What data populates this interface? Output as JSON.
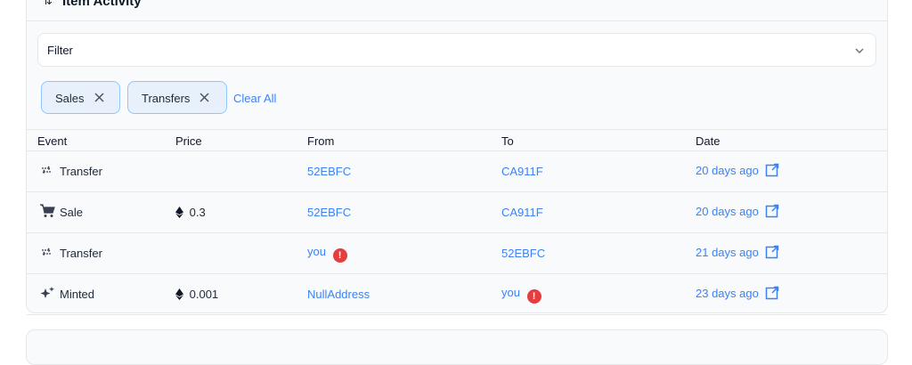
{
  "panel": {
    "title": "Item Activity",
    "title_icon": "swap-vertical-icon"
  },
  "filter": {
    "label": "Filter",
    "icon": "chevron-down-icon"
  },
  "chips": [
    {
      "label": "Sales",
      "icon": "close-icon"
    },
    {
      "label": "Transfers",
      "icon": "close-icon"
    }
  ],
  "clear_all": "Clear All",
  "table": {
    "headers": {
      "event": "Event",
      "price": "Price",
      "from": "From",
      "to": "To",
      "date": "Date"
    },
    "rows": [
      {
        "event": "Transfer",
        "event_icon": "transfer-icon",
        "price": "",
        "from": "52EBFC",
        "from_warn": false,
        "to": "CA911F",
        "to_warn": false,
        "date": "20 days ago"
      },
      {
        "event": "Sale",
        "event_icon": "cart-icon",
        "price": "0.3",
        "from": "52EBFC",
        "from_warn": false,
        "to": "CA911F",
        "to_warn": false,
        "date": "20 days ago"
      },
      {
        "event": "Transfer",
        "event_icon": "transfer-icon",
        "price": "",
        "from": "you",
        "from_warn": true,
        "to": "52EBFC",
        "to_warn": false,
        "date": "21 days ago"
      },
      {
        "event": "Minted",
        "event_icon": "sparkle-icon",
        "price": "0.001",
        "from": "NullAddress",
        "from_warn": false,
        "to": "you",
        "to_warn": true,
        "date": "23 days ago"
      }
    ]
  },
  "colors": {
    "accent": "#3b82f6",
    "warning": "#e53e3e",
    "chip_bg": "#e8f1fb"
  }
}
